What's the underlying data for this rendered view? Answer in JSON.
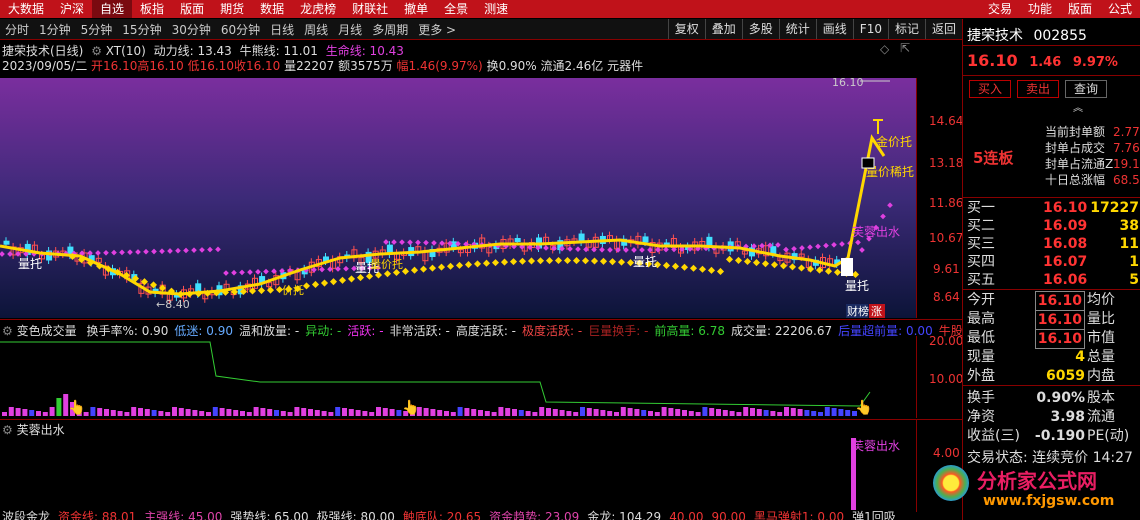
{
  "topbar": {
    "items": [
      "大数据",
      "沪深",
      "自选",
      "板指",
      "版面",
      "期货",
      "数据",
      "龙虎榜",
      "财联社",
      "撤单",
      "全景",
      "测速"
    ],
    "active": 2,
    "right": [
      "交易",
      "功能",
      "版面",
      "公式"
    ]
  },
  "periodbar": {
    "items": [
      "分时",
      "1分钟",
      "5分钟",
      "15分钟",
      "30分钟",
      "60分钟",
      "日线",
      "周线",
      "月线",
      "多周期",
      "更多 >"
    ],
    "tools": [
      "复权",
      "叠加",
      "多股",
      "统计",
      "画线",
      "F10",
      "标记",
      "返回"
    ]
  },
  "info1": {
    "name": "捷荣技术(日线)",
    "xt": "XT(10)",
    "dongli": "动力线: 13.43",
    "niuxiong": "牛熊线: 11.01",
    "shengming": "生命线: 10.43"
  },
  "info2": {
    "date": "2023/09/05/二",
    "open": "开16.10",
    "high": "高16.10",
    "low": "低16.10",
    "close": "收16.10",
    "vol": "量22207",
    "amount": "额3575万",
    "range": "幅1.46(9.97%)",
    "turnover": "换0.90%",
    "float": "流通2.46亿",
    "sector": "元器件"
  },
  "indicator1": {
    "name": "变色成交量",
    "items": [
      {
        "t": "换手率%: 0.90",
        "c": "#ddd"
      },
      {
        "t": "低迷: 0.90",
        "c": "#6af"
      },
      {
        "t": "温和放量: -",
        "c": "#ddd"
      },
      {
        "t": "异动: -",
        "c": "#3c3"
      },
      {
        "t": "活跃: -",
        "c": "#e3e"
      },
      {
        "t": "非常活跃: -",
        "c": "#ddd"
      },
      {
        "t": "高度活跃: -",
        "c": "#ddd"
      },
      {
        "t": "极度活跃: -",
        "c": "#e44"
      },
      {
        "t": "巨量换手: -",
        "c": "#a22"
      },
      {
        "t": "前高量: 6.78",
        "c": "#3c3"
      },
      {
        "t": "成交量: 22206.67",
        "c": "#ddd"
      },
      {
        "t": "后量超前量: 0.00",
        "c": "#44f"
      },
      {
        "t": "牛股启",
        "c": "#e33"
      }
    ]
  },
  "indicator2": {
    "name": "芙蓉出水"
  },
  "indicator3": {
    "items": [
      {
        "t": "波段金龙",
        "c": "#ddd"
      },
      {
        "t": "资金线: 88.01",
        "c": "#e33"
      },
      {
        "t": "主强线: 45.00",
        "c": "#d4a"
      },
      {
        "t": "强势线: 65.00",
        "c": "#ddd"
      },
      {
        "t": "极强线: 80.00",
        "c": "#ddd"
      },
      {
        "t": "触底队: 20.65",
        "c": "#e33"
      },
      {
        "t": "资金趋势: 23.09",
        "c": "#d4a"
      },
      {
        "t": "金龙: 104.29",
        "c": "#ddd"
      },
      {
        "t": "40.00",
        "c": "#e33"
      },
      {
        "t": "90.00",
        "c": "#e33"
      },
      {
        "t": "黑马弹射1: 0.00",
        "c": "#e33"
      },
      {
        "t": "弹1回吸",
        "c": "#ddd"
      }
    ]
  },
  "price_axis": [
    "14.64",
    "13.18",
    "11.86",
    "10.67",
    "9.61",
    "8.64"
  ],
  "vol_axis": [
    "20.00",
    "10.00"
  ],
  "fr_axis": [
    "4.00"
  ],
  "chart_labels": {
    "high_mark": "16.10",
    "low_mark": "8.40",
    "support": "量托",
    "price_support": "价托",
    "volprice_support": "量价托",
    "fr": "芙蓉出水",
    "jiaotuo": "金价托",
    "ljtuo": "量价稀托",
    "badge1": "财榜",
    "badge2": "涨"
  },
  "side": {
    "name": "捷荣技术",
    "code": "002855",
    "price": "16.10",
    "chg": "1.46",
    "pct": "9.97%",
    "buy": "买入",
    "sell": "卖出",
    "query": "查询",
    "lianban": "5连板",
    "fd": [
      {
        "k": "当前封单额",
        "v": "2.77"
      },
      {
        "k": "封单占成交",
        "v": "7.76"
      },
      {
        "k": "封单占流通Z",
        "v": "19.1"
      },
      {
        "k": "十日总涨幅",
        "v": "68.5"
      }
    ],
    "book": [
      {
        "k": "买一",
        "p": "16.10",
        "v": "17227"
      },
      {
        "k": "买二",
        "p": "16.09",
        "v": "38"
      },
      {
        "k": "买三",
        "p": "16.08",
        "v": "11"
      },
      {
        "k": "买四",
        "p": "16.07",
        "v": "1"
      },
      {
        "k": "买五",
        "p": "16.06",
        "v": "5"
      }
    ],
    "stats1": [
      {
        "k": "今开",
        "v": "16.10",
        "k2": "均价"
      },
      {
        "k": "最高",
        "v": "16.10",
        "k2": "量比"
      },
      {
        "k": "最低",
        "v": "16.10",
        "k2": "市值"
      },
      {
        "k": "现量",
        "v": "4",
        "k2": "总量"
      },
      {
        "k": "外盘",
        "v": "6059",
        "k2": "内盘"
      }
    ],
    "stats2": [
      {
        "k": "换手",
        "v": "0.90%",
        "k2": "股本"
      },
      {
        "k": "净资",
        "v": "3.98",
        "k2": "流通"
      },
      {
        "k": "收益(三)",
        "v": "-0.190",
        "k2": "PE(动)"
      }
    ],
    "status": "交易状态: 连续竞价 14:27"
  },
  "watermark": {
    "name": "分析家公式网",
    "url": "www.fxjgsw.com"
  },
  "colors": {
    "red": "#ff3333",
    "yellow": "#ffd700",
    "magenta": "#e040e0",
    "cyan": "#40e0ff"
  }
}
